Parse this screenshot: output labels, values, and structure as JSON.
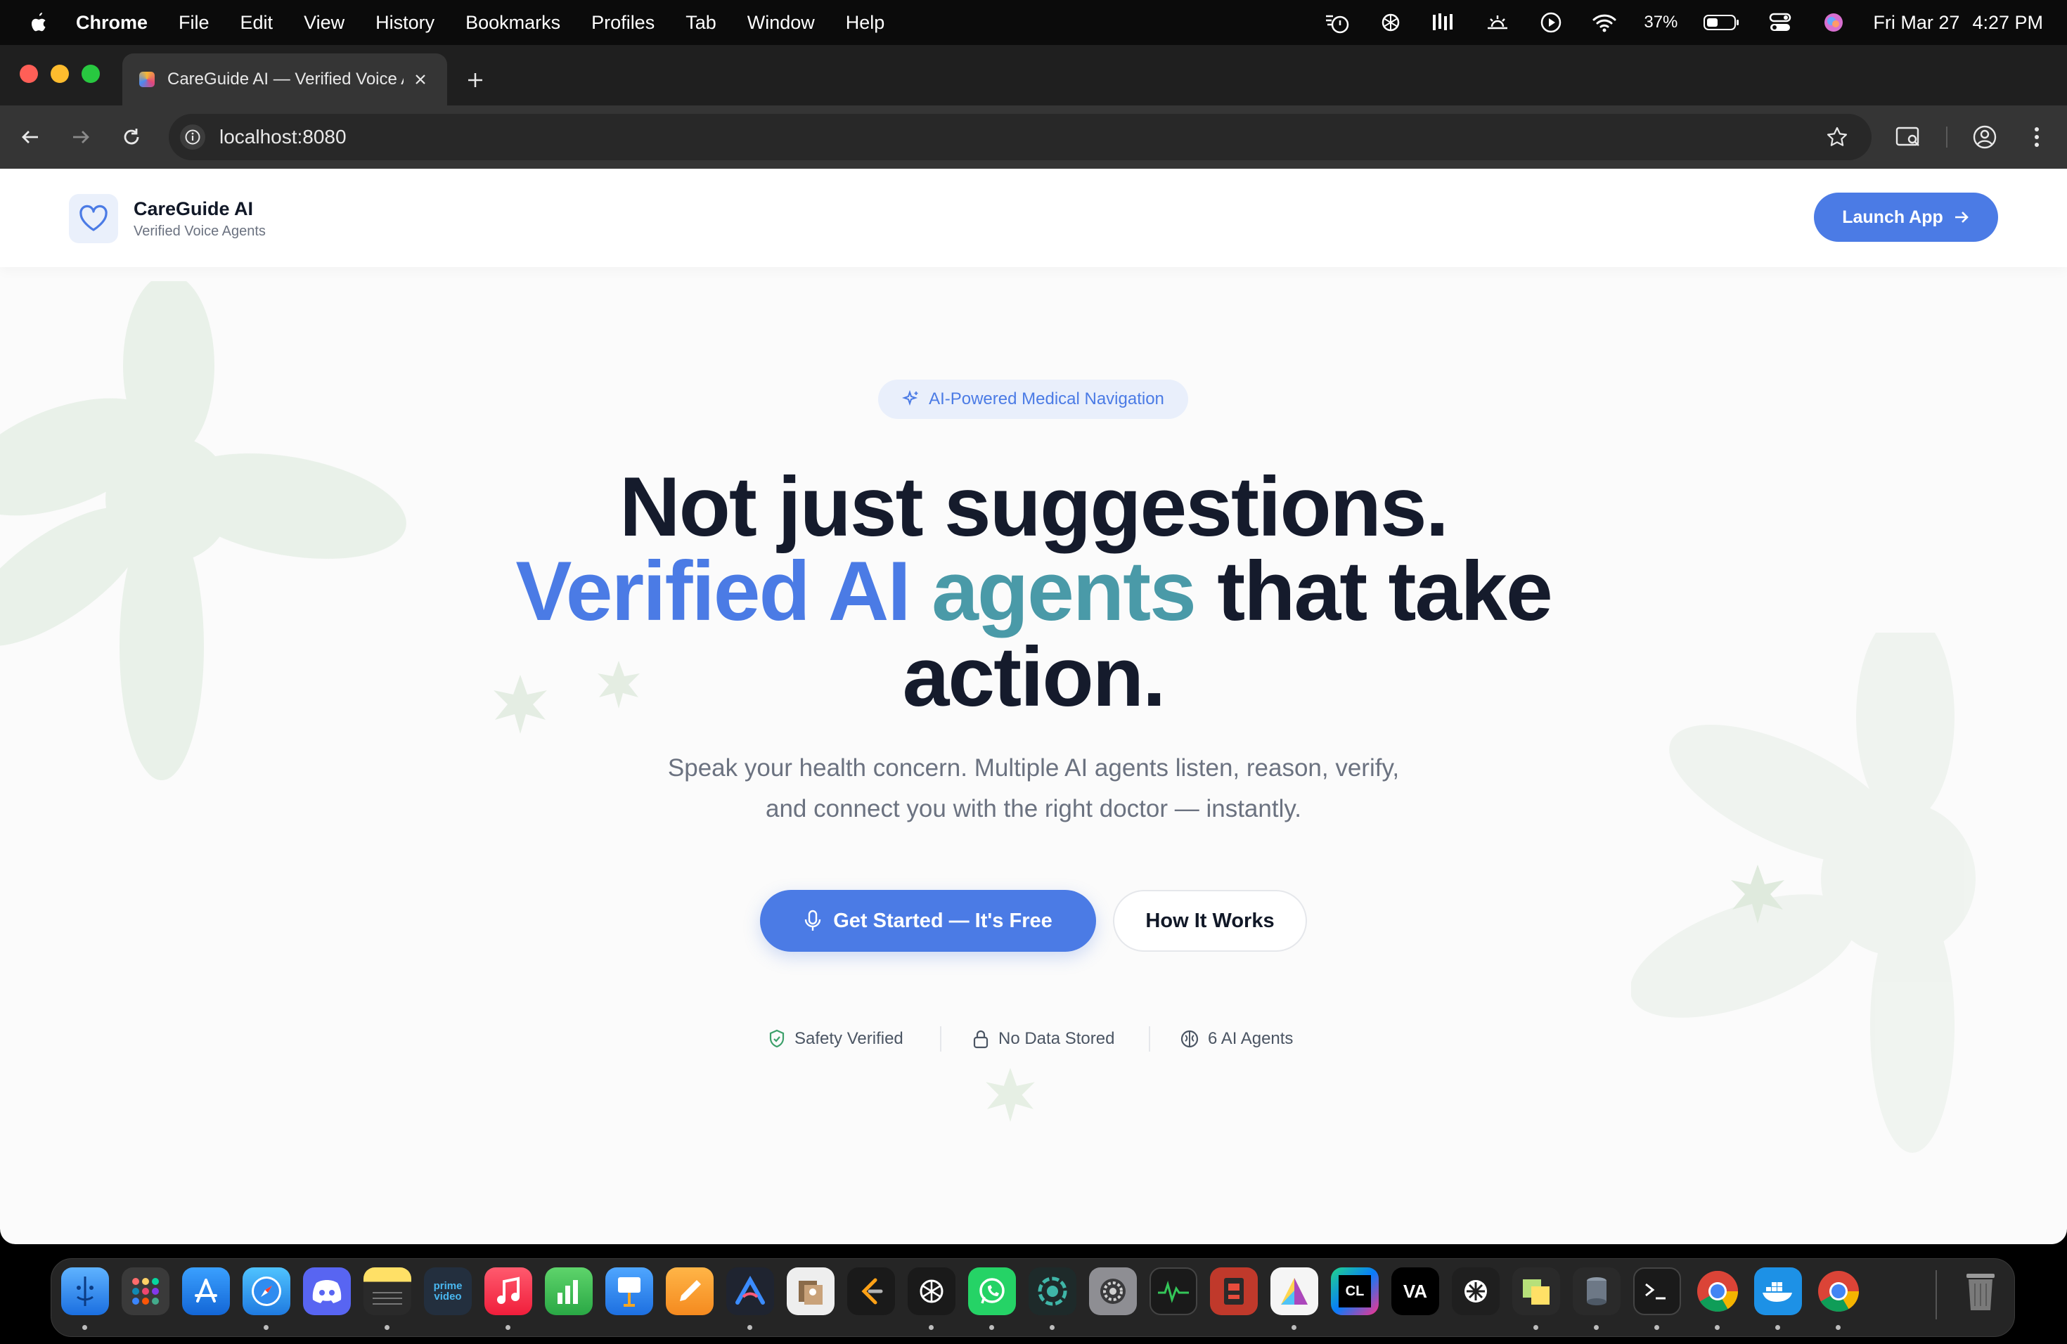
{
  "menubar": {
    "app_name": "Chrome",
    "items": [
      "File",
      "Edit",
      "View",
      "History",
      "Bookmarks",
      "Profiles",
      "Tab",
      "Window",
      "Help"
    ],
    "battery": "37%",
    "date": "Fri Mar 27",
    "time": "4:27 PM"
  },
  "browser": {
    "tab_title": "CareGuide AI — Verified Voice Agents",
    "url": "localhost:8080"
  },
  "site": {
    "brand_name": "CareGuide AI",
    "brand_tagline": "Verified Voice Agents",
    "launch_label": "Launch App",
    "accent_color": "#4b7be5"
  },
  "hero": {
    "badge": "AI-Powered Medical Navigation",
    "headline_line1": "Not just suggestions.",
    "headline_accent1": "Verified AI",
    "headline_accent2": "agents",
    "headline_rest": "that take",
    "headline_line3": "action.",
    "subtitle_line1": "Speak your health concern. Multiple AI agents listen, reason, verify,",
    "subtitle_line2": "and connect you with the right doctor — instantly.",
    "cta_primary": "Get Started — It's Free",
    "cta_secondary": "How It Works",
    "trust": [
      "Safety Verified",
      "No Data Stored",
      "6 AI Agents"
    ]
  },
  "dock": {
    "apps": [
      "finder-icon",
      "launchpad-icon",
      "app-store-icon",
      "safari-icon",
      "discord-icon",
      "notes-icon",
      "prime-video-icon",
      "music-icon",
      "numbers-icon",
      "keynote-icon",
      "pages-icon",
      "arc-icon",
      "preview-icon",
      "leetcode-icon",
      "chatgpt-icon",
      "whatsapp-icon",
      "screen-recorder-icon",
      "system-settings-icon",
      "activity-monitor-icon",
      "mirror-icon",
      "instruments-icon",
      "clion-icon",
      "vs-icon",
      "perplexity-icon",
      "stickies-icon",
      "vault-icon",
      "terminal-icon",
      "chrome-icon",
      "docker-icon",
      "chrome-canary-icon",
      "trash-icon"
    ],
    "prime_label": "prime video",
    "clion_label": "CL",
    "vs_label": "VA"
  }
}
